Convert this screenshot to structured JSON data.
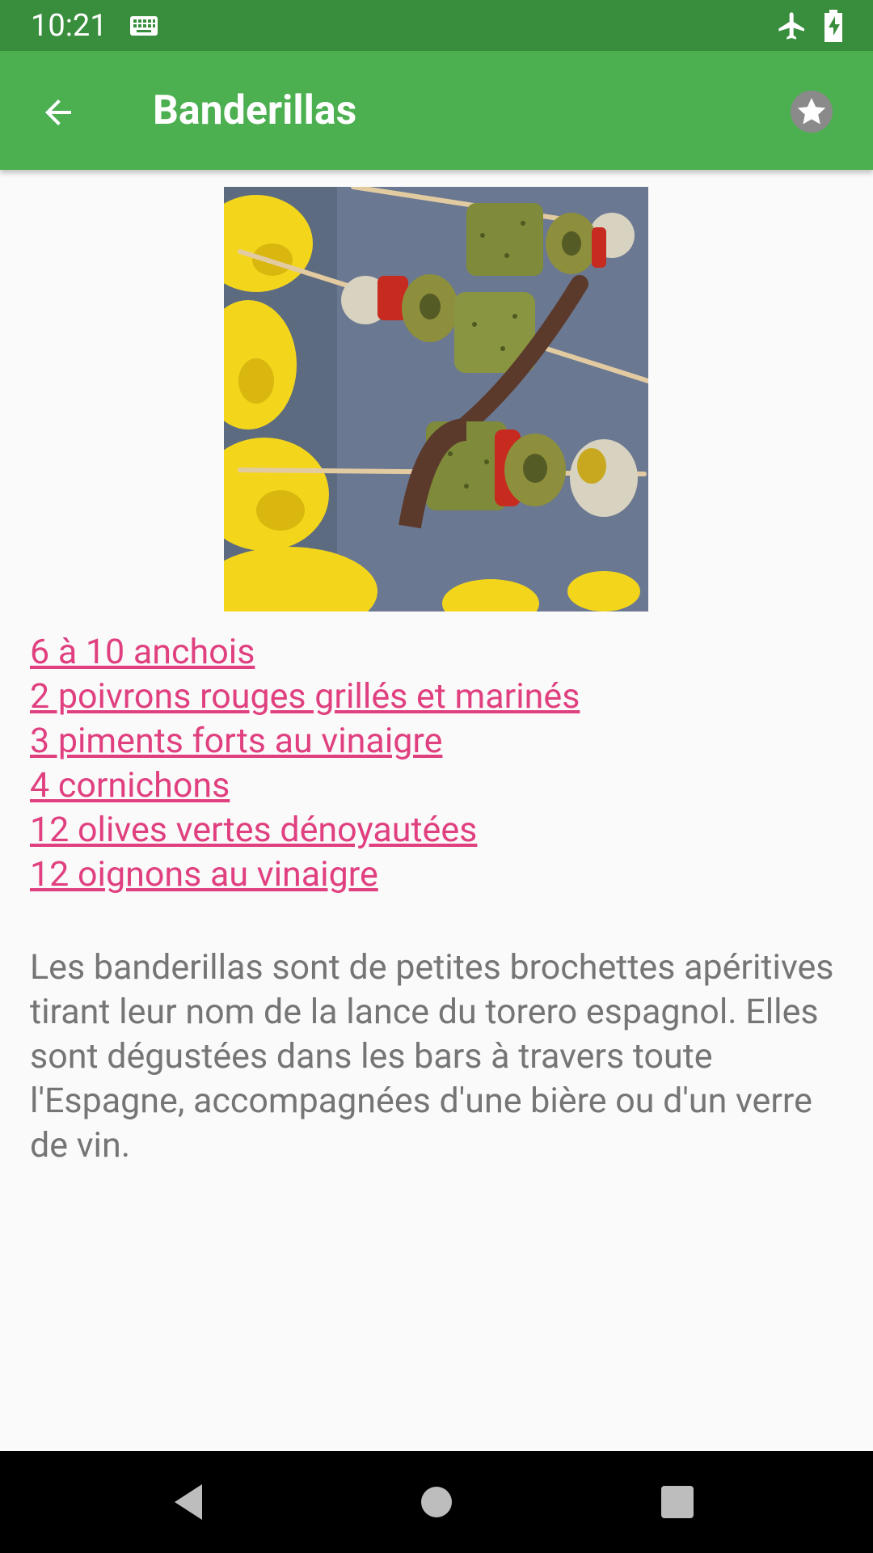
{
  "status_bar": {
    "time": "10:21",
    "icons": [
      "keyboard-icon",
      "airplane-icon",
      "battery-charging-icon"
    ],
    "background": "#388e3c"
  },
  "app_bar": {
    "title": "Banderillas",
    "back_icon": "arrow-back-icon",
    "favorite_icon": "star-icon",
    "background": "#4caf50"
  },
  "recipe": {
    "photo_description": "banderillas-skewers-photo",
    "ingredients": [
      "6 à 10 anchois",
      "2 poivrons rouges grillés et marinés",
      "3 piments forts au vinaigre",
      "4 cornichons",
      "12 olives vertes dénoyautées",
      "12 oignons au vinaigre"
    ],
    "description": "Les banderillas sont de petites brochettes apéritives tirant leur nom de la lance du torero espagnol. Elles sont dégustées dans les bars à travers toute l'Espagne, accompagnées d'une bière ou d'un verre de vin.",
    "link_color": "#e0407f",
    "text_color": "#757575"
  },
  "nav_bar": {
    "buttons": [
      "back-triangle-icon",
      "home-circle-icon",
      "recents-square-icon"
    ]
  }
}
